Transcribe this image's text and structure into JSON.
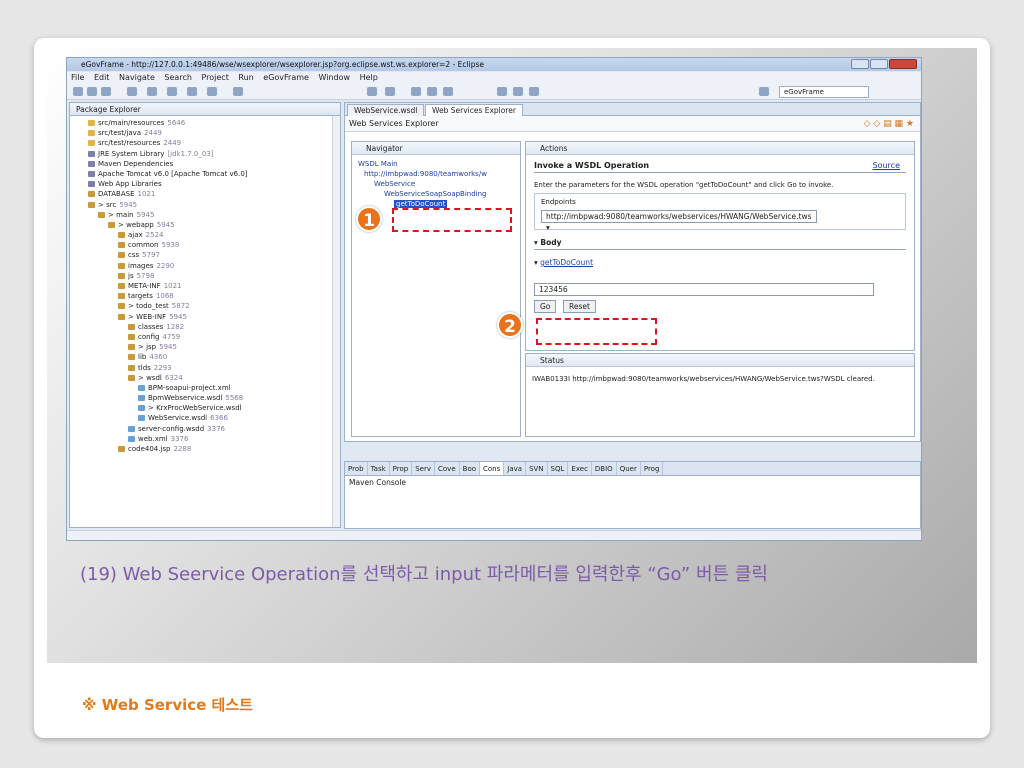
{
  "window": {
    "title": "eGovFrame - http://127.0.0.1:49486/wse/wsexplorer/wsexplorer.jsp?org.eclipse.wst.ws.explorer=2 - Eclipse"
  },
  "menu": [
    "File",
    "Edit",
    "Navigate",
    "Search",
    "Project",
    "Run",
    "eGovFrame",
    "Window",
    "Help"
  ],
  "perspective": "eGovFrame",
  "package_explorer": {
    "title": "Package Explorer",
    "items": [
      {
        "label": "src/main/resources",
        "num": "5646",
        "indent": 18,
        "icon": "f"
      },
      {
        "label": "src/test/java",
        "num": "2449",
        "indent": 18,
        "icon": "f"
      },
      {
        "label": "src/test/resources",
        "num": "2449",
        "indent": 18,
        "icon": "f"
      },
      {
        "label": "JRE System Library",
        "num": "[jdk1.7.0_03]",
        "indent": 18,
        "icon": "j"
      },
      {
        "label": "Maven Dependencies",
        "num": "",
        "indent": 18,
        "icon": "j"
      },
      {
        "label": "Apache Tomcat v6.0 [Apache Tomcat v6.0]",
        "num": "",
        "indent": 18,
        "icon": "j"
      },
      {
        "label": "Web App Libraries",
        "num": "",
        "indent": 18,
        "icon": "j"
      },
      {
        "label": "DATABASE",
        "num": "1021",
        "indent": 18,
        "icon": "p"
      },
      {
        "label": "> src",
        "num": "5945",
        "indent": 18,
        "icon": "p"
      },
      {
        "label": "> main",
        "num": "5945",
        "indent": 28,
        "icon": "p"
      },
      {
        "label": "> webapp",
        "num": "5945",
        "indent": 38,
        "icon": "p"
      },
      {
        "label": "ajax",
        "num": "2524",
        "indent": 48,
        "icon": "p"
      },
      {
        "label": "common",
        "num": "5938",
        "indent": 48,
        "icon": "p"
      },
      {
        "label": "css",
        "num": "5797",
        "indent": 48,
        "icon": "p"
      },
      {
        "label": "images",
        "num": "2290",
        "indent": 48,
        "icon": "p"
      },
      {
        "label": "js",
        "num": "5798",
        "indent": 48,
        "icon": "p"
      },
      {
        "label": "META-INF",
        "num": "1021",
        "indent": 48,
        "icon": "p"
      },
      {
        "label": "targets",
        "num": "1068",
        "indent": 48,
        "icon": "p"
      },
      {
        "label": "> todo_test",
        "num": "5872",
        "indent": 48,
        "icon": "p"
      },
      {
        "label": "> WEB-INF",
        "num": "5945",
        "indent": 48,
        "icon": "p"
      },
      {
        "label": "classes",
        "num": "1282",
        "indent": 58,
        "icon": "p"
      },
      {
        "label": "config",
        "num": "4759",
        "indent": 58,
        "icon": "p"
      },
      {
        "label": "> jsp",
        "num": "5945",
        "indent": 58,
        "icon": "p"
      },
      {
        "label": "lib",
        "num": "4360",
        "indent": 58,
        "icon": "p"
      },
      {
        "label": "tlds",
        "num": "2293",
        "indent": 58,
        "icon": "p"
      },
      {
        "label": "> wsdl",
        "num": "6324",
        "indent": 58,
        "icon": "p"
      },
      {
        "label": "BPM-soapui-project.xml",
        "num": "",
        "indent": 68,
        "icon": "w"
      },
      {
        "label": "BpmWebservice.wsdl",
        "num": "5568",
        "indent": 68,
        "icon": "w"
      },
      {
        "label": "> KrxProcWebService.wsdl",
        "num": "",
        "indent": 68,
        "icon": "w"
      },
      {
        "label": "WebService.wsdl",
        "num": "6366",
        "indent": 68,
        "icon": "w"
      },
      {
        "label": "server-config.wsdd",
        "num": "3376",
        "indent": 58,
        "icon": "w"
      },
      {
        "label": "web.xml",
        "num": "3376",
        "indent": 58,
        "icon": "w"
      },
      {
        "label": "code404.jsp",
        "num": "2288",
        "indent": 48,
        "icon": "p"
      }
    ]
  },
  "editor_tabs": [
    "WebService.wsdl",
    "Web Services Explorer"
  ],
  "wse_title": "Web Services Explorer",
  "navigator": {
    "title": "Navigator",
    "items": [
      {
        "label": "WSDL Main",
        "indent": 6
      },
      {
        "label": "http://imbpwad:9080/teamworks/w",
        "indent": 12
      },
      {
        "label": "WebService",
        "indent": 22
      },
      {
        "label": "WebServiceSoapSoapBinding",
        "indent": 32
      },
      {
        "label": "getToDoCount",
        "indent": 42,
        "selected": true
      }
    ]
  },
  "actions": {
    "title": "Actions",
    "heading": "Invoke a WSDL Operation",
    "source_link": "Source",
    "instruction": "Enter the parameters for the WSDL operation \"getToDoCount\" and click Go to invoke.",
    "endpoints_label": "Endpoints",
    "endpoint_value": "http://imbpwad:9080/teamworks/webservices/HWANG/WebService.tws",
    "body_label": "Body",
    "operation_link": "getToDoCount",
    "param_value": "123456",
    "go": "Go",
    "reset": "Reset"
  },
  "status": {
    "title": "Status",
    "message": "IWAB0133I http://imbpwad:9080/teamworks/webservices/HWANG/WebService.tws?WSDL cleared."
  },
  "bottom_tabs": [
    "Prob",
    "Task",
    "Prop",
    "Serv",
    "Cove",
    "Boo",
    "Cons",
    "Java",
    "SVN",
    "SQL",
    "Exec",
    "DBIO",
    "Quer",
    "Prog"
  ],
  "console_title": "Maven Console",
  "markers": [
    "1",
    "2"
  ],
  "caption": "(19) Web Seervice Operation를 선택하고 input 파라메터를 입력한후 “Go” 버튼 클릭",
  "footer": "※ Web Service 테스트",
  "colors": {
    "marker": "#e8731b",
    "dash": "#e0141e",
    "caption": "#7b5ca8",
    "footer": "#e07a1a"
  }
}
